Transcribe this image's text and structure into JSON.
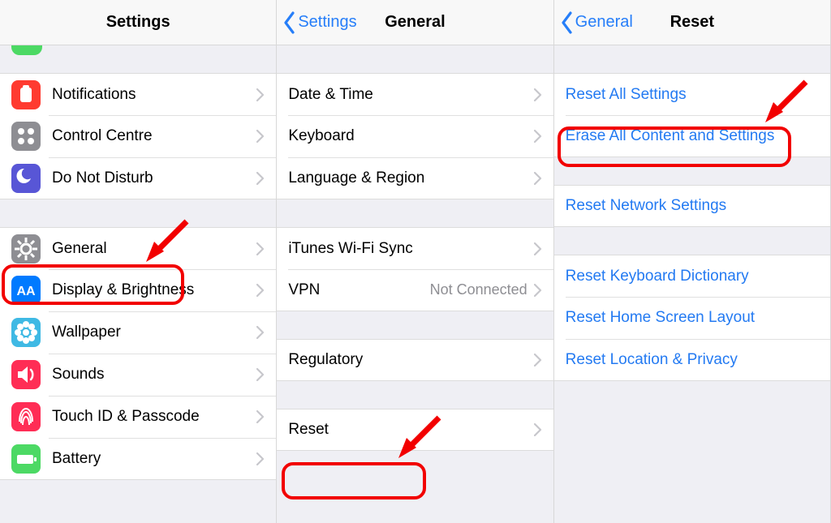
{
  "panel1": {
    "title": "Settings",
    "items_top": [
      {
        "label": "Notifications",
        "icon": "notifications",
        "color": "#ff3b30"
      },
      {
        "label": "Control Centre",
        "icon": "control",
        "color": "#8e8e93"
      },
      {
        "label": "Do Not Disturb",
        "icon": "moon",
        "color": "#5856d6"
      }
    ],
    "items_bottom": [
      {
        "label": "General",
        "icon": "gear",
        "color": "#8e8e93"
      },
      {
        "label": "Display & Brightness",
        "icon": "aa",
        "color": "#007aff"
      },
      {
        "label": "Wallpaper",
        "icon": "flower",
        "color": "#3fb9e4"
      },
      {
        "label": "Sounds",
        "icon": "speaker",
        "color": "#ff2d55"
      },
      {
        "label": "Touch ID & Passcode",
        "icon": "finger",
        "color": "#ff2d55"
      },
      {
        "label": "Battery",
        "icon": "battery",
        "color": "#4cd964"
      }
    ]
  },
  "panel2": {
    "back": "Settings",
    "title": "General",
    "group1": [
      {
        "label": "Date & Time"
      },
      {
        "label": "Keyboard"
      },
      {
        "label": "Language & Region"
      }
    ],
    "group2": [
      {
        "label": "iTunes Wi-Fi Sync"
      },
      {
        "label": "VPN",
        "value": "Not Connected"
      }
    ],
    "group3": [
      {
        "label": "Regulatory"
      }
    ],
    "group4": [
      {
        "label": "Reset"
      }
    ]
  },
  "panel3": {
    "back": "General",
    "title": "Reset",
    "group1": [
      {
        "label": "Reset All Settings"
      },
      {
        "label": "Erase All Content and Settings"
      }
    ],
    "group2": [
      {
        "label": "Reset Network Settings"
      }
    ],
    "group3": [
      {
        "label": "Reset Keyboard Dictionary"
      },
      {
        "label": "Reset Home Screen Layout"
      },
      {
        "label": "Reset Location & Privacy"
      }
    ]
  }
}
